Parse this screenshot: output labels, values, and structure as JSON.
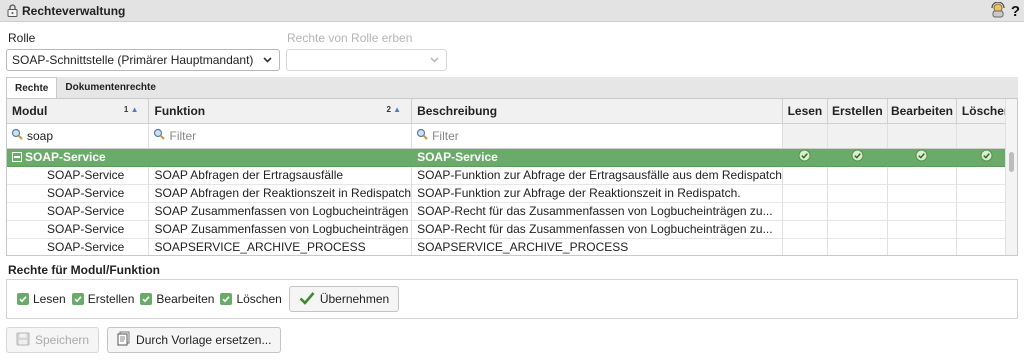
{
  "window": {
    "title": "Rechteverwaltung"
  },
  "form": {
    "rolle_label": "Rolle",
    "rolle_value": "SOAP-Schnittstelle (Primärer Hauptmandant)",
    "erben_label": "Rechte von Rolle erben",
    "erben_value": ""
  },
  "tabs": [
    {
      "label": "Rechte",
      "active": true
    },
    {
      "label": "Dokumentenrechte",
      "active": false
    }
  ],
  "grid": {
    "columns": [
      {
        "label": "Modul",
        "sort": "1"
      },
      {
        "label": "Funktion",
        "sort": "2"
      },
      {
        "label": "Beschreibung",
        "sort": ""
      },
      {
        "label": "Lesen",
        "sort": ""
      },
      {
        "label": "Erstellen",
        "sort": ""
      },
      {
        "label": "Bearbeiten",
        "sort": ""
      },
      {
        "label": "Löschen",
        "sort": ""
      }
    ],
    "filters": {
      "modul_value": "soap",
      "funktion_placeholder": "Filter",
      "beschreibung_placeholder": "Filter"
    },
    "group": {
      "modul": "SOAP-Service",
      "beschreibung": "SOAP-Service",
      "lesen": true,
      "erstellen": true,
      "bearbeiten": true,
      "loeschen": true
    },
    "rows": [
      {
        "modul": "SOAP-Service",
        "funktion": "SOAP Abfragen der Ertragsausfälle",
        "beschreibung": "SOAP-Funktion zur Abfrage der Ertragsausfälle aus dem Redispatch"
      },
      {
        "modul": "SOAP-Service",
        "funktion": "SOAP Abfragen der Reaktionszeit in Redispatch",
        "beschreibung": "SOAP-Funktion zur Abfrage der Reaktionszeit in Redispatch."
      },
      {
        "modul": "SOAP-Service",
        "funktion": "SOAP Zusammenfassen von Logbucheinträgen",
        "beschreibung": "SOAP-Recht für das Zusammenfassen von Logbucheinträgen zu..."
      },
      {
        "modul": "SOAP-Service",
        "funktion": "SOAP Zusammenfassen von Logbucheinträgen",
        "beschreibung": "SOAP-Recht für das Zusammenfassen von Logbucheinträgen zu..."
      },
      {
        "modul": "SOAP-Service",
        "funktion": "SOAPSERVICE_ARCHIVE_PROCESS",
        "beschreibung": "SOAPSERVICE_ARCHIVE_PROCESS"
      }
    ],
    "check_color": "#6aab6a"
  },
  "rights": {
    "label": "Rechte für Modul/Funktion",
    "checkboxes": [
      {
        "label": "Lesen",
        "checked": true
      },
      {
        "label": "Erstellen",
        "checked": true
      },
      {
        "label": "Bearbeiten",
        "checked": true
      },
      {
        "label": "Löschen",
        "checked": true
      }
    ],
    "apply_label": "Übernehmen"
  },
  "footer": {
    "save_label": "Speichern",
    "template_label": "Durch Vorlage ersetzen..."
  }
}
